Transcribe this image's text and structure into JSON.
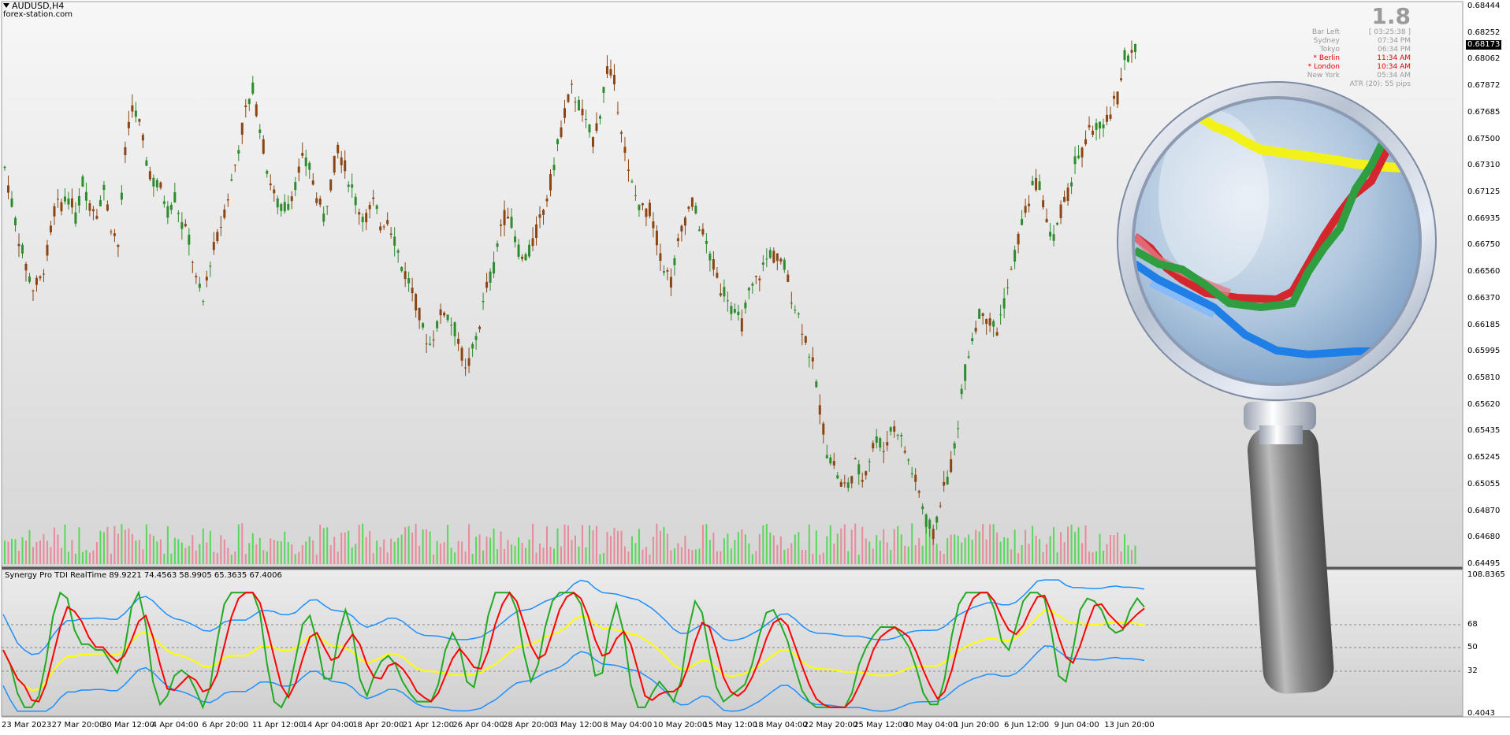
{
  "window": {
    "symbol_title": "AUDUSD,H4",
    "watermark": "forex-station.com"
  },
  "price_axis": {
    "ticks": [
      "0.68444",
      "0.68252",
      "0.68062",
      "0.67872",
      "0.67685",
      "0.67500",
      "0.67310",
      "0.67125",
      "0.66935",
      "0.66750",
      "0.66560",
      "0.66370",
      "0.66185",
      "0.65995",
      "0.65810",
      "0.65620",
      "0.65435",
      "0.65245",
      "0.65055",
      "0.64870",
      "0.64680",
      "0.64495"
    ],
    "current_price": "0.68173"
  },
  "info_panel": {
    "value": "1.8",
    "rows": [
      {
        "name": "Bar Left",
        "value": "[ 03:25:38 ]",
        "highlight": false
      },
      {
        "name": "Sydney",
        "value": "07:34 PM",
        "highlight": false
      },
      {
        "name": "Tokyo",
        "value": "06:34 PM",
        "highlight": false
      },
      {
        "name": "* Berlin",
        "value": "11:34 AM",
        "highlight": true
      },
      {
        "name": "* London",
        "value": "10:34 AM",
        "highlight": true
      },
      {
        "name": "New York",
        "value": "05:34 AM",
        "highlight": false
      }
    ],
    "atr": "ATR (20): 55 pips",
    "highlight_color": "#e00000",
    "normal_color": "#999999"
  },
  "indicator": {
    "title": "Synergy Pro TDI RealTime 89.9221 74.4563 58.9905 65.3635 67.4006",
    "axis_ticks": [
      "108.8365",
      "68",
      "50",
      "32",
      "0.4043"
    ],
    "colors": {
      "upper_band": "#1e90ff",
      "lower_band": "#1e90ff",
      "signal": "#ffff00",
      "rsi_price": "#22aa22",
      "trade_signal": "#ff0000"
    }
  },
  "time_axis": {
    "ticks": [
      "23 Mar 2023",
      "27 Mar 20:00",
      "30 Mar 12:00",
      "4 Apr 04:00",
      "6 Apr 20:00",
      "11 Apr 12:00",
      "14 Apr 04:00",
      "18 Apr 20:00",
      "21 Apr 12:00",
      "26 Apr 04:00",
      "28 Apr 20:00",
      "3 May 12:00",
      "8 May 04:00",
      "10 May 20:00",
      "15 May 12:00",
      "18 May 04:00",
      "22 May 20:00",
      "25 May 12:00",
      "30 May 04:00",
      "1 Jun 20:00",
      "6 Jun 12:00",
      "9 Jun 04:00",
      "13 Jun 20:00"
    ]
  },
  "colors": {
    "bull_candle": "#2e8b2e",
    "bear_candle": "#8b4513",
    "volume_up": "#5ad65a",
    "volume_down": "#e88a9a",
    "panel_bg_top": "#f6f6f6",
    "panel_bg_bottom": "#d8d8d8"
  },
  "chart_data": {
    "type": "candlestick",
    "close_path": [
      0.673,
      0.6705,
      0.668,
      0.666,
      0.6645,
      0.665,
      0.667,
      0.67,
      0.6705,
      0.671,
      0.6695,
      0.672,
      0.6705,
      0.67,
      0.6715,
      0.669,
      0.6675,
      0.674,
      0.6775,
      0.676,
      0.6735,
      0.672,
      0.6715,
      0.67,
      0.671,
      0.669,
      0.668,
      0.665,
      0.6635,
      0.6665,
      0.668,
      0.67,
      0.672,
      0.6745,
      0.677,
      0.6785,
      0.676,
      0.673,
      0.671,
      0.67,
      0.6705,
      0.672,
      0.6735,
      0.673,
      0.671,
      0.6695,
      0.672,
      0.6745,
      0.673,
      0.6715,
      0.67,
      0.6695,
      0.6705,
      0.669,
      0.6695,
      0.668,
      0.666,
      0.665,
      0.6635,
      0.6615,
      0.6605,
      0.662,
      0.663,
      0.662,
      0.661,
      0.6585,
      0.66,
      0.662,
      0.6645,
      0.666,
      0.669,
      0.67,
      0.668,
      0.6665,
      0.667,
      0.6685,
      0.67,
      0.672,
      0.6745,
      0.677,
      0.6785,
      0.6775,
      0.676,
      0.675,
      0.677,
      0.68,
      0.679,
      0.676,
      0.6725,
      0.671,
      0.67,
      0.67,
      0.668,
      0.666,
      0.665,
      0.6675,
      0.6695,
      0.6705,
      0.669,
      0.6675,
      0.666,
      0.6645,
      0.664,
      0.6625,
      0.662,
      0.664,
      0.665,
      0.666,
      0.667,
      0.6665,
      0.666,
      0.664,
      0.6625,
      0.661,
      0.659,
      0.656,
      0.653,
      0.652,
      0.6505,
      0.6505,
      0.652,
      0.651,
      0.6525,
      0.654,
      0.653,
      0.6545,
      0.6545,
      0.653,
      0.6515,
      0.65,
      0.648,
      0.647,
      0.6495,
      0.651,
      0.653,
      0.657,
      0.66,
      0.662,
      0.663,
      0.662,
      0.6615,
      0.6635,
      0.6655,
      0.668,
      0.67,
      0.6715,
      0.672,
      0.669,
      0.668,
      0.67,
      0.671,
      0.6735,
      0.674,
      0.6755,
      0.676,
      0.6755,
      0.677,
      0.678,
      0.681,
      0.681,
      0.6815
    ],
    "ylim": [
      0.64495,
      0.68444
    ]
  }
}
